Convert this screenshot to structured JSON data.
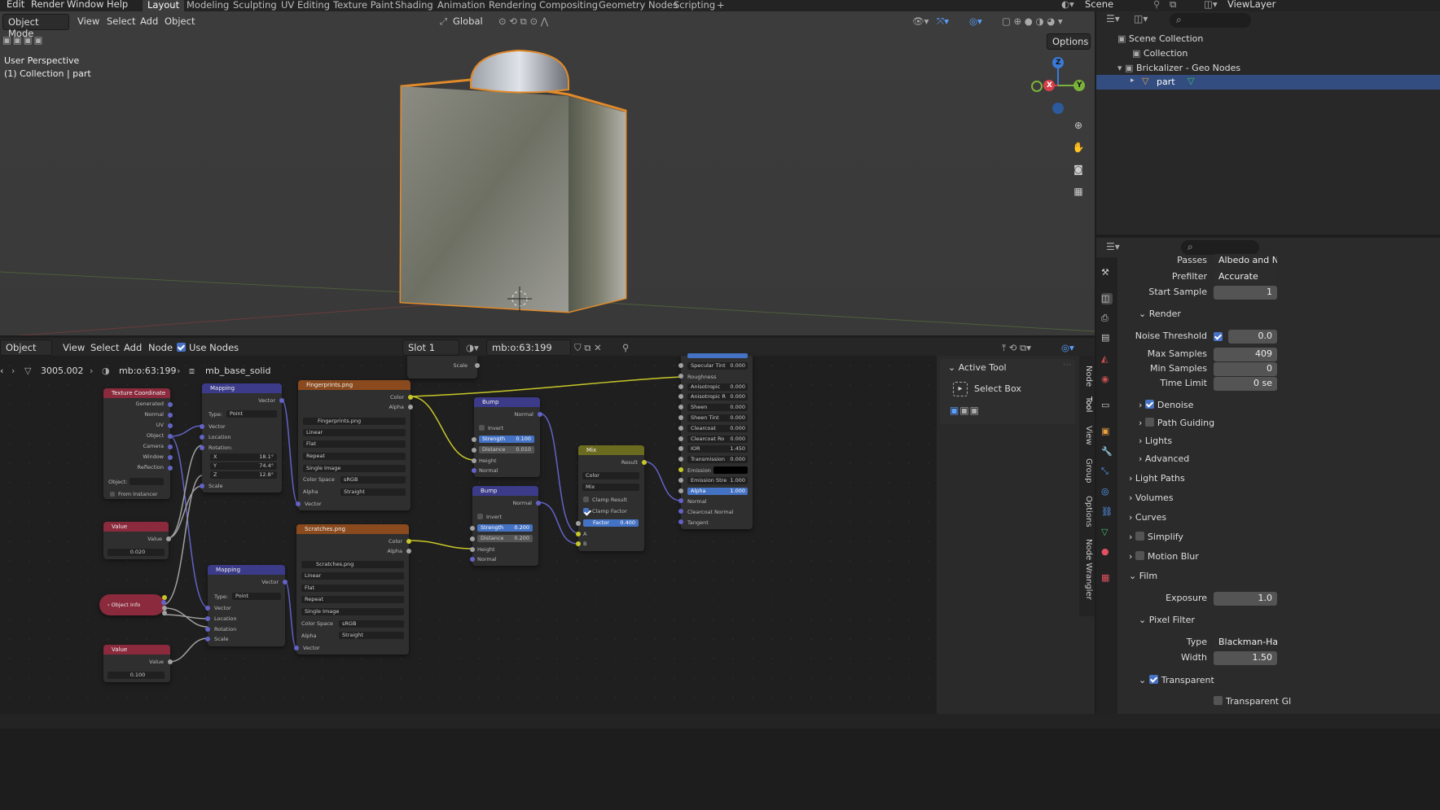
{
  "topmenu": {
    "items": [
      "Edit",
      "Render",
      "Window",
      "Help"
    ],
    "workspaces": [
      "Layout",
      "Modeling",
      "Sculpting",
      "UV Editing",
      "Texture Paint",
      "Shading",
      "Animation",
      "Rendering",
      "Compositing",
      "Geometry Nodes",
      "Scripting"
    ],
    "active_workspace": "Layout",
    "add_tab": "+",
    "scene": "Scene",
    "view_layer": "ViewLayer"
  },
  "viewport": {
    "mode": "Object Mode",
    "menus": [
      "View",
      "Select",
      "Add",
      "Object"
    ],
    "orientation": "Global",
    "options": "Options",
    "info_line1": "User Perspective",
    "info_line2": "(1) Collection | part",
    "gizmo": {
      "x": "X",
      "y": "Y",
      "z": "Z"
    }
  },
  "node_editor": {
    "editor_type": "Object",
    "menus": [
      "View",
      "Select",
      "Add",
      "Node"
    ],
    "use_nodes": "Use Nodes",
    "slot": "Slot 1",
    "material": "mb:o:63:199",
    "breadcrumb": [
      "3005.002",
      "mb:o:63:199",
      "mb_base_solid"
    ],
    "sidebar_tabs": [
      "Node",
      "Tool",
      "View",
      "Group",
      "Options",
      "Node Wrangler"
    ],
    "active_tool_title": "Active Tool",
    "active_tool_name": "Select Box",
    "nodes": {
      "texcoord": {
        "title": "Texture Coordinate",
        "outputs": [
          "Generated",
          "Normal",
          "UV",
          "Object",
          "Camera",
          "Window",
          "Reflection"
        ],
        "object_label": "Object:",
        "from_instancer": "From Instancer"
      },
      "mapping1": {
        "title": "Mapping",
        "out": "Vector",
        "type_label": "Type:",
        "type": "Point",
        "inputs": [
          "Vector",
          "Location",
          "Rotation:",
          "Scale"
        ],
        "rx": "X",
        "ry": "Y",
        "rz": "Z",
        "rxv": "18.1°",
        "ryv": "74.4°",
        "rzv": "12.8°"
      },
      "mapping2": {
        "title": "Mapping",
        "out": "Vector",
        "type_label": "Type:",
        "type": "Point",
        "inputs": [
          "Vector",
          "Location",
          "Rotation",
          "Scale"
        ]
      },
      "value1": {
        "title": "Value",
        "out": "Value",
        "val": "0.020"
      },
      "value2": {
        "title": "Value",
        "out": "Value",
        "val": "0.100"
      },
      "objinfo": {
        "title": "Object Info"
      },
      "img1": {
        "title": "Fingerprints.png",
        "outs": [
          "Color",
          "Alpha"
        ],
        "file": "Fingerprints.png",
        "interp": "Linear",
        "proj": "Flat",
        "ext": "Repeat",
        "src": "Single Image",
        "cs_label": "Color Space",
        "cs": "sRGB",
        "alpha_label": "Alpha",
        "alpha": "Straight",
        "in": "Vector"
      },
      "img2": {
        "title": "Scratches.png",
        "outs": [
          "Color",
          "Alpha"
        ],
        "file": "Scratches.png",
        "interp": "Linear",
        "proj": "Flat",
        "ext": "Repeat",
        "src": "Single Image",
        "cs_label": "Color Space",
        "cs": "sRGB",
        "alpha_label": "Alpha",
        "alpha": "Straight",
        "in": "Vector"
      },
      "bump1": {
        "title": "Bump",
        "out": "Normal",
        "invert": "Invert",
        "strength": "Strength",
        "strength_v": "0.100",
        "distance": "Distance",
        "distance_v": "0.010",
        "height": "Height",
        "normal": "Normal"
      },
      "bump2": {
        "title": "Bump",
        "out": "Normal",
        "invert": "Invert",
        "strength": "Strength",
        "strength_v": "0.200",
        "distance": "Distance",
        "distance_v": "0.200",
        "height": "Height",
        "normal": "Normal"
      },
      "mix": {
        "title": "Mix",
        "out": "Result",
        "dtype": "Color",
        "blend": "Mix",
        "clamp_result": "Clamp Result",
        "clamp_factor": "Clamp Factor",
        "factor": "Factor",
        "factor_v": "0.400",
        "a": "A",
        "b": "B"
      },
      "top_partial": {
        "scale": "Scale"
      },
      "bsdf": {
        "rows": [
          [
            "Specular Tint",
            "0.000"
          ],
          [
            "Roughness",
            ""
          ],
          [
            "Anisotropic",
            "0.000"
          ],
          [
            "Anisotropic R",
            "0.000"
          ],
          [
            "Sheen",
            "0.000"
          ],
          [
            "Sheen Tint",
            "0.000"
          ],
          [
            "Clearcoat",
            "0.000"
          ],
          [
            "Clearcoat Ro",
            "0.000"
          ],
          [
            "IOR",
            "1.450"
          ],
          [
            "Transmission",
            "0.000"
          ],
          [
            "Emission",
            ""
          ],
          [
            "Emission Stre",
            "1.000"
          ],
          [
            "Alpha",
            "1.000"
          ],
          [
            "Normal",
            ""
          ],
          [
            "Clearcoat Normal",
            ""
          ],
          [
            "Tangent",
            ""
          ]
        ]
      }
    }
  },
  "outliner": {
    "items": [
      "Scene Collection",
      "Collection",
      "Brickalizer - Geo Nodes",
      "part"
    ]
  },
  "properties": {
    "passes_label": "Passes",
    "passes": "Albedo and Norm",
    "prefilter_label": "Prefilter",
    "prefilter": "Accurate",
    "start_sample_label": "Start Sample",
    "start_sample": "1",
    "render": "Render",
    "noise_threshold": "Noise Threshold",
    "noise_threshold_v": "0.0",
    "max_samples": "Max Samples",
    "max_samples_v": "409",
    "min_samples": "Min Samples",
    "min_samples_v": "0",
    "time_limit": "Time Limit",
    "time_limit_v": "0 se",
    "denoise": "Denoise",
    "path_guiding": "Path Guiding",
    "lights": "Lights",
    "advanced": "Advanced",
    "light_paths": "Light Paths",
    "volumes": "Volumes",
    "curves": "Curves",
    "simplify": "Simplify",
    "motion_blur": "Motion Blur",
    "film": "Film",
    "exposure": "Exposure",
    "exposure_v": "1.0",
    "pixel_filter": "Pixel Filter",
    "type": "Type",
    "type_v": "Blackman-Harris",
    "width": "Width",
    "width_v": "1.50",
    "transparent": "Transparent",
    "transparent_glass": "Transparent Gl"
  }
}
